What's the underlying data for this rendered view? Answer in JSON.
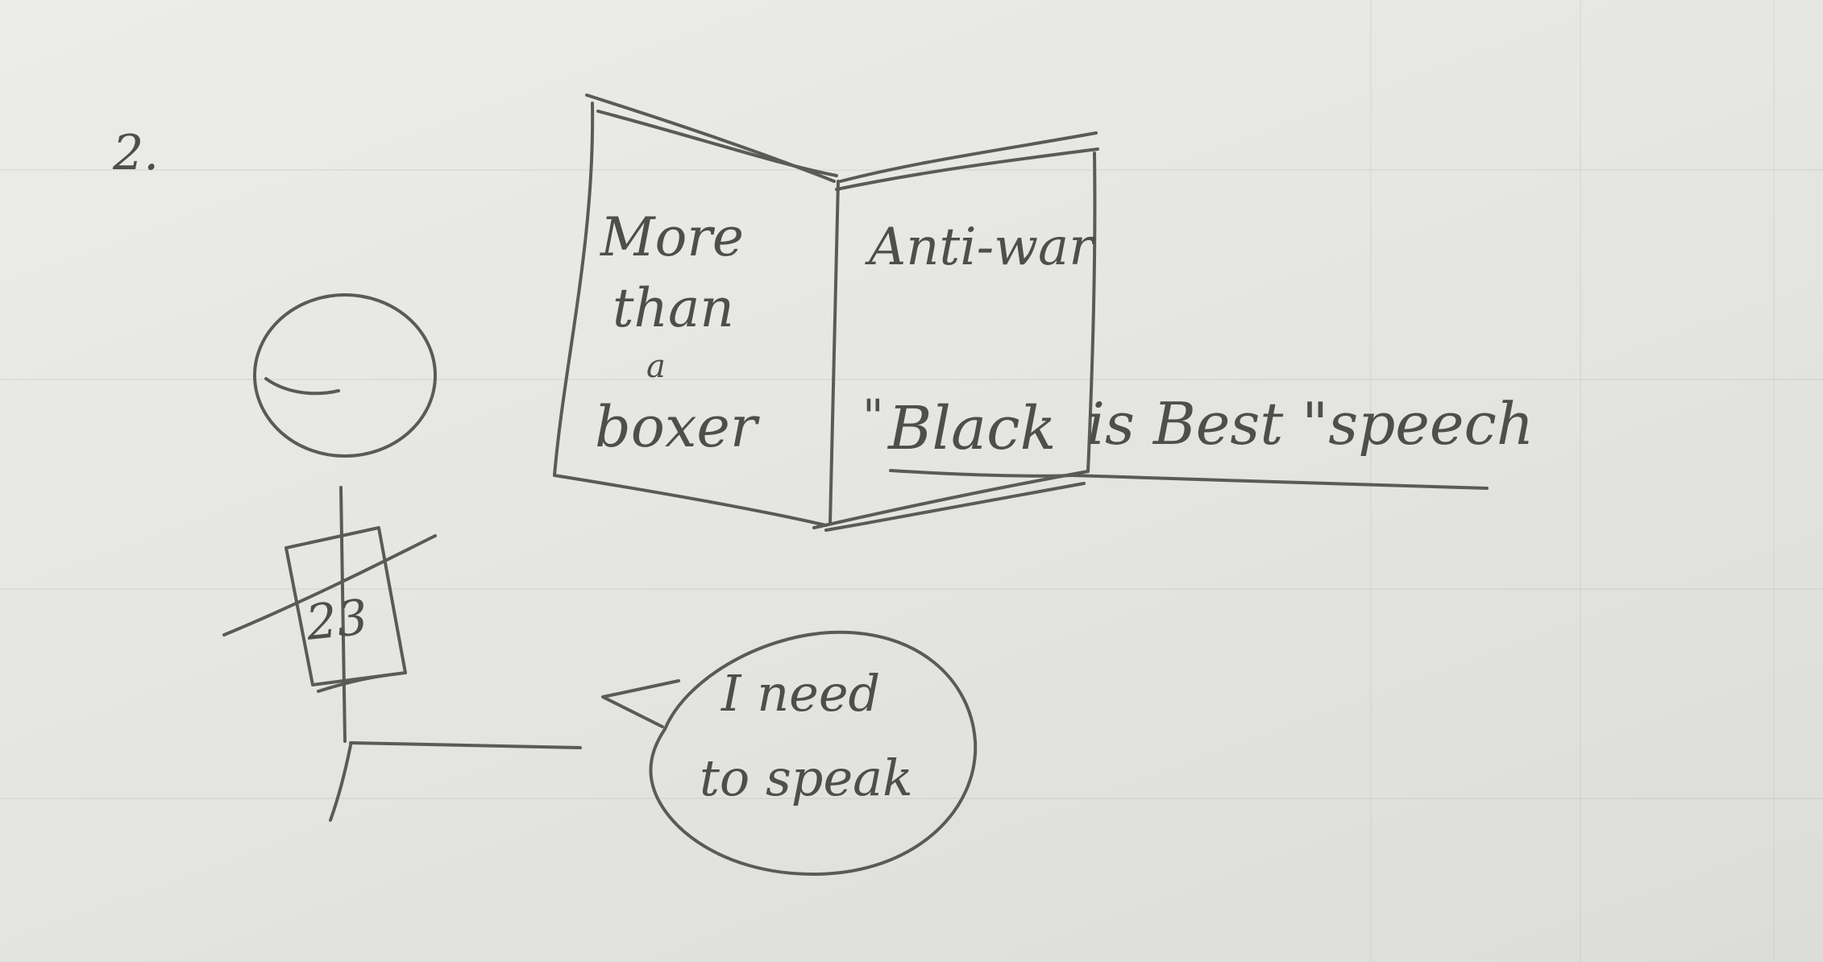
{
  "page_number": "2.",
  "book": {
    "left_page": {
      "line1": "More",
      "line2": "than",
      "line3": "a",
      "line4": "boxer"
    },
    "right_page": {
      "title": "Anti-war",
      "speech_open_quote": "\"",
      "speech_word_black": "Black",
      "speech_rest": "is Best \"speech"
    }
  },
  "figure": {
    "shirt_number": "23"
  },
  "speech_bubble": {
    "line1": "I need",
    "line2": "to speak"
  }
}
